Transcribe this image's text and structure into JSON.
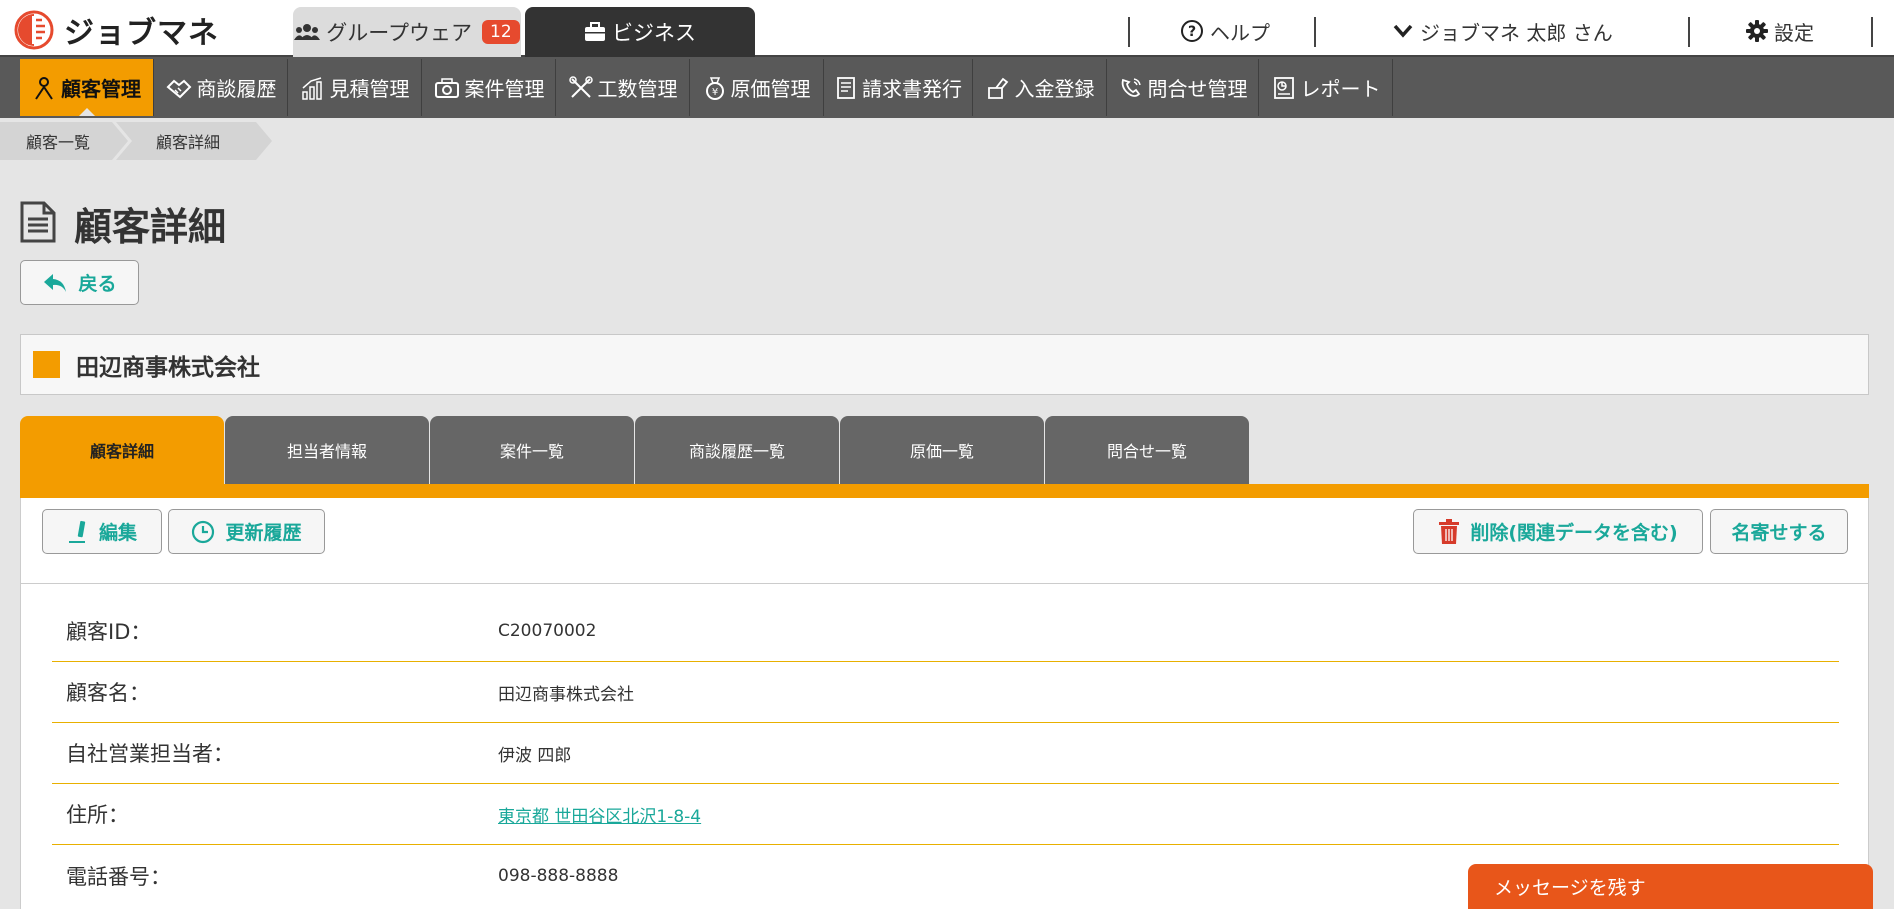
{
  "app": {
    "logo_text": "ジョブマネ"
  },
  "system_tabs": {
    "groupware": {
      "label": "グループウェア",
      "badge": "12"
    },
    "business": {
      "label": "ビジネス"
    }
  },
  "top_links": {
    "help": "ヘルプ",
    "user": "ジョブマネ 太郎 さん",
    "settings": "設定"
  },
  "main_nav": [
    {
      "label": "顧客管理",
      "icon": "person-icon",
      "active": true
    },
    {
      "label": "商談履歴",
      "icon": "handshake-icon"
    },
    {
      "label": "見積管理",
      "icon": "chart-icon"
    },
    {
      "label": "案件管理",
      "icon": "camera-icon"
    },
    {
      "label": "工数管理",
      "icon": "tools-icon"
    },
    {
      "label": "原価管理",
      "icon": "money-bag-icon"
    },
    {
      "label": "請求書発行",
      "icon": "invoice-icon"
    },
    {
      "label": "入金登録",
      "icon": "deposit-icon"
    },
    {
      "label": "問合せ管理",
      "icon": "phone-icon"
    },
    {
      "label": "レポート",
      "icon": "report-icon"
    }
  ],
  "breadcrumb": [
    "顧客一覧",
    "顧客詳細"
  ],
  "page": {
    "title": "顧客詳細",
    "back_label": "戻る",
    "company_name": "田辺商事株式会社"
  },
  "tabs": [
    {
      "label": "顧客詳細",
      "active": true
    },
    {
      "label": "担当者情報"
    },
    {
      "label": "案件一覧"
    },
    {
      "label": "商談履歴一覧"
    },
    {
      "label": "原価一覧"
    },
    {
      "label": "問合せ一覧"
    }
  ],
  "toolbar": {
    "edit": "編集",
    "history": "更新履歴",
    "delete": "削除(関連データを含む)",
    "merge": "名寄せする"
  },
  "details": [
    {
      "label": "顧客ID：",
      "value": "C20070002"
    },
    {
      "label": "顧客名：",
      "value": "田辺商事株式会社"
    },
    {
      "label": "自社営業担当者：",
      "value": "伊波 四郎"
    },
    {
      "label": "住所：",
      "value": "東京都 世田谷区北沢1-8-4",
      "link": true
    },
    {
      "label": "電話番号：",
      "value": "098-888-8888"
    }
  ],
  "message": {
    "label": "メッセージを残す"
  },
  "colors": {
    "accent": "#f39c00",
    "link": "#1aa89a",
    "danger": "#d63b2b",
    "message": "#e8561a"
  }
}
